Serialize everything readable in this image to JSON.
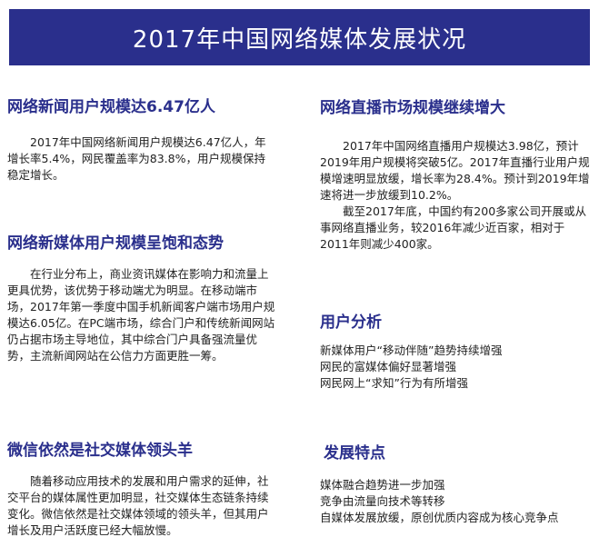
{
  "title": "2017年中国网络媒体发展状况",
  "left": [
    {
      "heading": "网络新闻用户规模达6.47亿人",
      "body": "2017年中国网络新闻用户规模达6.47亿人，年增长率5.4%，网民覆盖率为83.8%，用户规模保持稳定增长。"
    },
    {
      "heading": "网络新媒体用户规模呈饱和态势",
      "body": "在行业分布上，商业资讯媒体在影响力和流量上更具优势，该优势于移动端尤为明显。在移动端市场，2017年第一季度中国手机新闻客户端市场用户规模达6.05亿。在PC端市场，综合门户和传统新闻网站仍占据市场主导地位，其中综合门户具备强流量优势，主流新闻网站在公信力方面更胜一筹。"
    },
    {
      "heading": "微信依然是社交媒体领头羊",
      "body": "随着移动应用技术的发展和用户需求的延伸，社交平台的媒体属性更加明显，社交媒体生态链条持续变化。微信依然是社交媒体领域的领头羊，但其用户增长及用户活跃度已经大幅放慢。"
    }
  ],
  "right": {
    "live": {
      "heading": "网络直播市场规模继续增大",
      "para1": "2017年中国网络直播用户规模达3.98亿，预计2019年用户规模将突破5亿。2017年直播行业用户规模增速明显放缓，增长率为28.4%。预计到2019年增速将进一步放缓到10.2%。",
      "para2": "截至2017年底，中国约有200多家公司开展或从事网络直播业务，较2016年减少近百家，相对于2011年则减少400家。"
    },
    "users": {
      "heading": "用户分析",
      "items": [
        "新媒体用户“移动伴随”趋势持续增强",
        "网民的富媒体偏好显著增强",
        "网民网上“求知”行为有所增强"
      ]
    },
    "features": {
      "heading": "发展特点",
      "items": [
        "媒体融合趋势进一步加强",
        "竞争由流量向技术等转移",
        "自媒体发展放缓，原创优质内容成为核心竞争点"
      ]
    }
  },
  "colors": {
    "header_bg": "#2a2f8c",
    "heading": "#2a2f8c",
    "text": "#222222"
  }
}
